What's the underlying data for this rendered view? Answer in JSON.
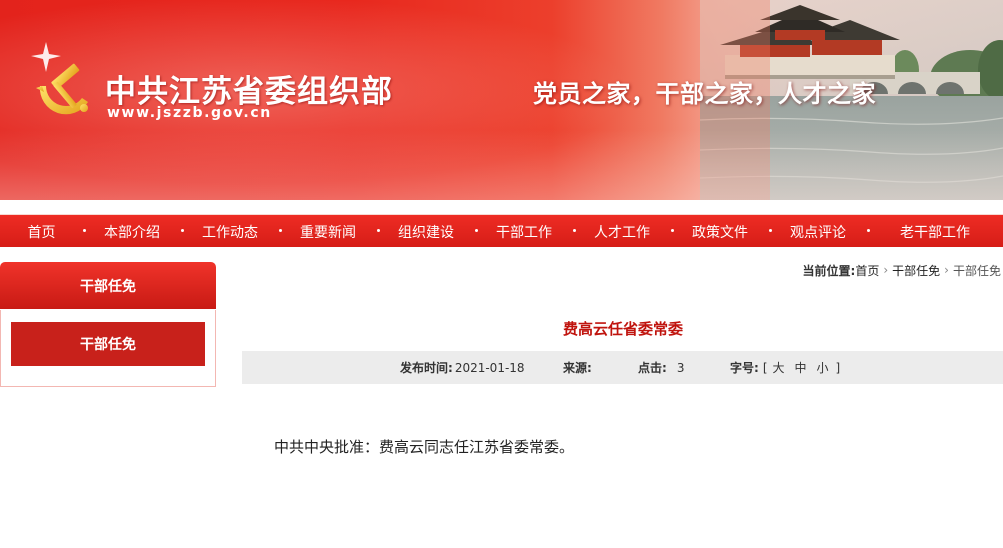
{
  "header": {
    "title": "中共江苏省委组织部",
    "url": "www.jszzb.gov.cn",
    "slogan": "党员之家，干部之家，人才之家"
  },
  "nav": {
    "items": [
      "首页",
      "本部介绍",
      "工作动态",
      "重要新闻",
      "组织建设",
      "干部工作",
      "人才工作",
      "政策文件",
      "观点评论",
      "老干部工作"
    ]
  },
  "sidebar": {
    "title": "干部任免",
    "items": [
      "干部任免"
    ]
  },
  "breadcrumb": {
    "label": "当前位置:",
    "items": [
      "首页",
      "干部任免",
      "干部任免"
    ]
  },
  "article": {
    "title": "费高云任省委常委",
    "meta": {
      "date_label": "发布时间:",
      "date": "2021-01-18",
      "source_label": "来源:",
      "source": "",
      "clicks_label": "点击:",
      "clicks": "3",
      "fontsize_label": "字号:",
      "fontsize_open": "[",
      "fontsize_large": "大",
      "fontsize_medium": "中",
      "fontsize_small": "小",
      "fontsize_close": "]"
    },
    "body": "中共中央批准：费高云同志任江苏省委常委。"
  },
  "colors": {
    "brand_red": "#d61d17",
    "title_red": "#c0140e",
    "meta_bg": "#ececec"
  }
}
